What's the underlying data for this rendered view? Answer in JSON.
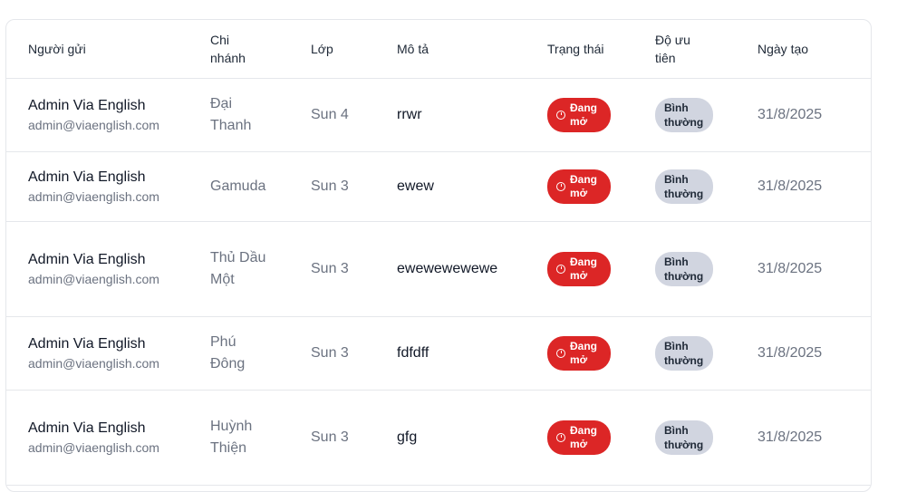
{
  "table": {
    "headers": {
      "sender": "Người gửi",
      "branch": "Chi nhánh",
      "class": "Lớp",
      "description": "Mô tả",
      "status": "Trạng thái",
      "priority": "Độ ưu tiên",
      "created": "Ngày tạo"
    },
    "rows": [
      {
        "name": "Admin Via English",
        "email": "admin@viaenglish.com",
        "branch": "Đại Thanh",
        "class": "Sun 4",
        "description": "rrwr",
        "status": "Đang mở",
        "priority": "Bình thường",
        "date": "31/8/2025"
      },
      {
        "name": "Admin Via English",
        "email": "admin@viaenglish.com",
        "branch": "Gamuda",
        "class": "Sun 3",
        "description": "ewew",
        "status": "Đang mở",
        "priority": "Bình thường",
        "date": "31/8/2025"
      },
      {
        "name": "Admin Via English",
        "email": "admin@viaenglish.com",
        "branch": "Thủ Dầu Một",
        "class": "Sun 3",
        "description": "ewewewewewe",
        "status": "Đang mở",
        "priority": "Bình thường",
        "date": "31/8/2025"
      },
      {
        "name": "Admin Via English",
        "email": "admin@viaenglish.com",
        "branch": "Phú Đông",
        "class": "Sun 3",
        "description": "fdfdff",
        "status": "Đang mở",
        "priority": "Bình thường",
        "date": "31/8/2025"
      },
      {
        "name": "Admin Via English",
        "email": "admin@viaenglish.com",
        "branch": "Huỳnh Thiện",
        "class": "Sun 3",
        "description": "gfg",
        "status": "Đang mở",
        "priority": "Bình thường",
        "date": "31/8/2025"
      }
    ]
  },
  "colors": {
    "status_open": "#dc2626",
    "priority_normal": "#d1d5e0",
    "border": "#e5e7eb",
    "muted_text": "#6b7280"
  },
  "icons": {
    "status": "clock-icon"
  }
}
